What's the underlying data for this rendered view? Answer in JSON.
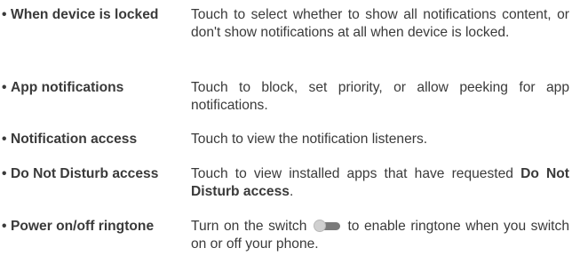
{
  "bullet_char": "•",
  "items": [
    {
      "term": "When device is locked",
      "description": "Touch to select whether to show all notifications content, or don't show notifications at all when device is locked."
    },
    {
      "term": "App notifications",
      "description": "Touch to block, set priority, or allow peeking for app notifications."
    },
    {
      "term": "Notification access",
      "description": "Touch to view the notification listeners."
    },
    {
      "term": "Do Not Disturb access",
      "description_before": "Touch to view installed apps that have requested ",
      "description_bold": "Do Not Disturb access",
      "description_after": "."
    },
    {
      "term": "Power on/off ringtone",
      "description_before": "Turn on the switch",
      "description_after": " to enable ringtone when you switch on or off your phone.",
      "icon": "toggle-switch-icon"
    }
  ],
  "colors": {
    "text": "#3a3a3a",
    "switch_track": "#7a7a7a",
    "switch_knob": "#d0d0d0"
  }
}
